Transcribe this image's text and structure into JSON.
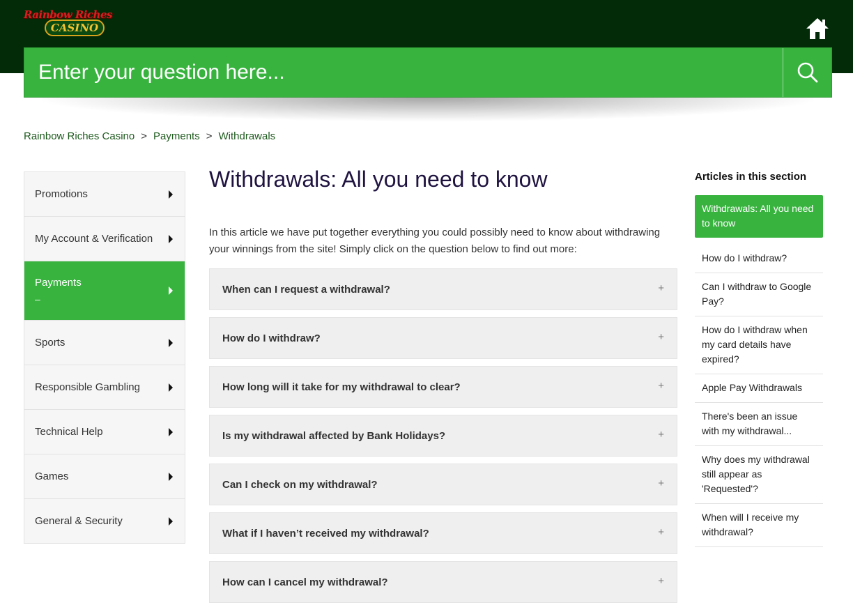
{
  "logo": {
    "top": "Rainbow Riches",
    "bottom": "CASINO"
  },
  "search": {
    "placeholder": "Enter your question here..."
  },
  "breadcrumb": [
    "Rainbow Riches Casino",
    "Payments",
    "Withdrawals"
  ],
  "breadcrumb_sep": ">",
  "side_nav": [
    {
      "label": "Promotions"
    },
    {
      "label": "My Account & Verification"
    },
    {
      "label": "Payments",
      "active": true,
      "sub": "–"
    },
    {
      "label": "Sports"
    },
    {
      "label": "Responsible Gambling"
    },
    {
      "label": "Technical Help"
    },
    {
      "label": "Games"
    },
    {
      "label": "General & Security"
    }
  ],
  "article": {
    "title": "Withdrawals: All you need to know",
    "intro": "In this article we have put together everything you could possibly need to know about withdrawing your winnings from the site! Simply click on the question below to find out more:",
    "faqs": [
      "When can I request a withdrawal?",
      "How do I withdraw?",
      "How long will it take for my withdrawal to clear?",
      "Is my withdrawal affected by Bank Holidays?",
      "Can I check on my withdrawal?",
      "What if I haven’t received my withdrawal?",
      "How can I cancel my withdrawal?"
    ],
    "expand_symbol": "+"
  },
  "section": {
    "heading": "Articles in this section",
    "items": [
      "Withdrawals: All you need to know",
      "How do I withdraw?",
      "Can I withdraw to Google Pay?",
      "How do I withdraw when my card details have expired?",
      "Apple Pay Withdrawals",
      "There's been an issue with my withdrawal...",
      "Why does my withdrawal still appear as 'Requested'?",
      "When will I receive my withdrawal?"
    ]
  },
  "colors": {
    "header": "#032b08",
    "accent": "#37b33e",
    "title": "#1f1340"
  },
  "icons": {
    "home": "home-icon",
    "search": "search-icon",
    "caret": "caret-right-icon"
  }
}
